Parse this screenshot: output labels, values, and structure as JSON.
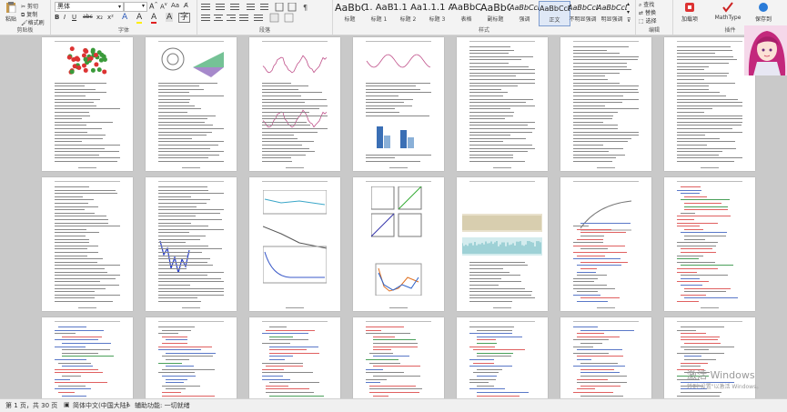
{
  "ribbon": {
    "clipboard": {
      "paste_label": "粘贴",
      "cut_label": "剪切",
      "copy_label": "复制",
      "format_painter_label": "格式刷",
      "group_label": "剪贴板"
    },
    "font": {
      "font_name": "黑体",
      "group_label": "字体",
      "bold": "B",
      "italic": "I",
      "underline": "U",
      "strike": "abc",
      "sub": "x₂",
      "sup": "x²",
      "font_color": "A",
      "highlight": "A",
      "char_shading": "A"
    },
    "paragraph": {
      "group_label": "段落"
    },
    "styles": {
      "group_label": "样式",
      "tiles": [
        {
          "sample": "AaBbC",
          "name": "标题"
        },
        {
          "sample": "1. AaBl",
          "name": "标题 1"
        },
        {
          "sample": "1.1 AaB",
          "name": "标题 2"
        },
        {
          "sample": "1.1.1 Aa",
          "name": "标题 3"
        },
        {
          "sample": "AaBbCcD",
          "name": "表格"
        },
        {
          "sample": "AaBbC",
          "name": "副标题"
        },
        {
          "sample": "AaBbCcD",
          "name": "强调"
        },
        {
          "sample": "AaBbCcDc",
          "name": "正文"
        },
        {
          "sample": "AaBbCcDc",
          "name": "不明显强调"
        },
        {
          "sample": "AaBbCcDc",
          "name": "明显强调"
        }
      ]
    },
    "editing": {
      "find": "查找",
      "replace": "替换",
      "select": "选择",
      "group_label": "编辑"
    },
    "addins": [
      {
        "label": "加载项"
      },
      {
        "label": "MathType"
      },
      {
        "label": "保存到"
      }
    ],
    "addins_group_label": "插件"
  },
  "status": {
    "page": "第 1 页，共 30 页",
    "language": "简体中文(中国大陆)",
    "accessibility": "辅助功能: 一切就绪"
  },
  "watermark": {
    "line1": "激活 Windows",
    "line2": "转到\"设置\"以激活 Windows。"
  }
}
